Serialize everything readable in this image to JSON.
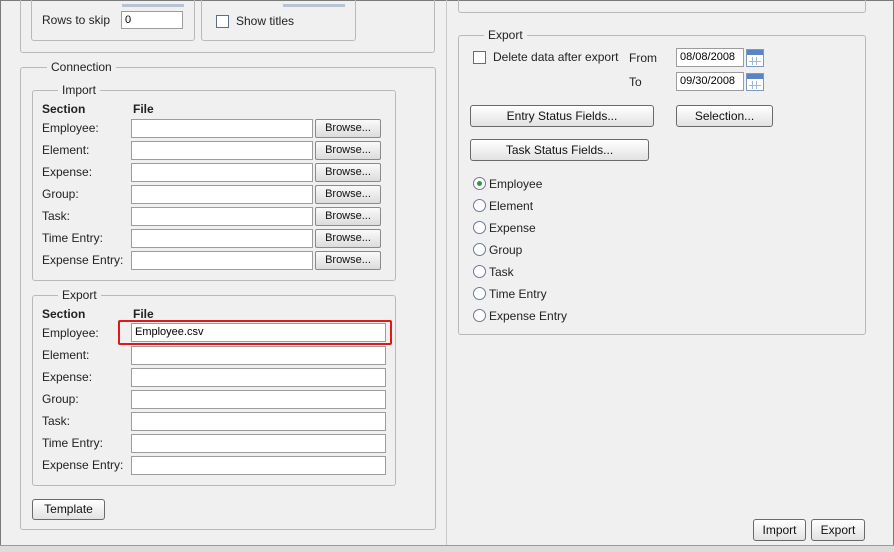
{
  "import_options": {
    "rows_to_skip_label": "Rows to skip",
    "rows_to_skip_value": "0",
    "show_titles_label": "Show titles"
  },
  "connection": {
    "title": "Connection",
    "import": {
      "title": "Import",
      "section_header": "Section",
      "file_header": "File",
      "browse_label": "Browse...",
      "rows": [
        {
          "label": "Employee:",
          "value": ""
        },
        {
          "label": "Element:",
          "value": ""
        },
        {
          "label": "Expense:",
          "value": ""
        },
        {
          "label": "Group:",
          "value": ""
        },
        {
          "label": "Task:",
          "value": ""
        },
        {
          "label": "Time Entry:",
          "value": ""
        },
        {
          "label": "Expense Entry:",
          "value": ""
        }
      ]
    },
    "export": {
      "title": "Export",
      "section_header": "Section",
      "file_header": "File",
      "rows": [
        {
          "label": "Employee:",
          "value": "Employee.csv"
        },
        {
          "label": "Element:",
          "value": ""
        },
        {
          "label": "Expense:",
          "value": ""
        },
        {
          "label": "Group:",
          "value": ""
        },
        {
          "label": "Task:",
          "value": ""
        },
        {
          "label": "Time Entry:",
          "value": ""
        },
        {
          "label": "Expense Entry:",
          "value": ""
        }
      ]
    },
    "template_button": "Template"
  },
  "export_panel": {
    "title": "Export",
    "delete_after_export_label": "Delete data after export",
    "from_label": "From",
    "from_value": "08/08/2008",
    "to_label": "To",
    "to_value": "09/30/2008",
    "entry_status_button": "Entry Status Fields...",
    "selection_button": "Selection...",
    "task_status_button": "Task Status Fields...",
    "options": [
      "Employee",
      "Element",
      "Expense",
      "Group",
      "Task",
      "Time Entry",
      "Expense Entry"
    ],
    "selected_option": "Employee"
  },
  "footer": {
    "import_button": "Import",
    "export_button": "Export"
  },
  "colors": {
    "highlight": "#e01818",
    "radio_selected": "#2d9b3a",
    "calendar_accent": "#5b84c4"
  },
  "icons": {
    "calendar": "calendar-icon"
  }
}
